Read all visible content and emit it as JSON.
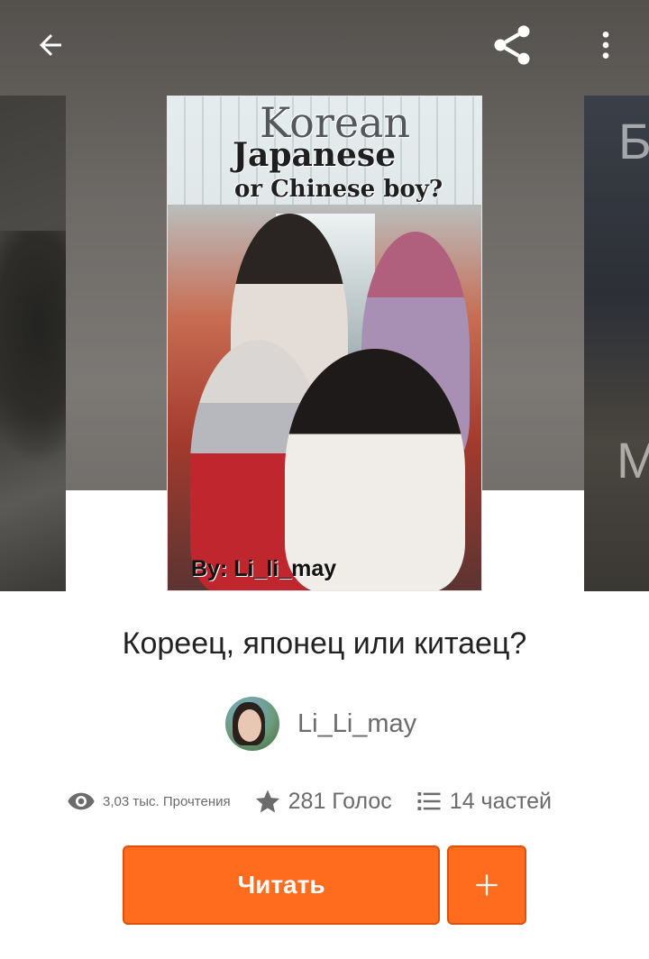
{
  "header": {
    "back_icon": "arrow-left-icon",
    "share_icon": "share-icon",
    "more_icon": "more-vertical-icon"
  },
  "cover": {
    "title_line1": "Korean",
    "title_line2": "Japanese",
    "title_line3": "or Chinese boy?",
    "byline": "By: Li_li_may"
  },
  "side_covers": {
    "right_letter_top": "Б",
    "right_letter_bottom": "М"
  },
  "story": {
    "title": "Кореец, японец или китаец?",
    "author": "Li_Li_may"
  },
  "stats": {
    "reads": "3,03 тыс. Прочтения",
    "votes": "281 Голос",
    "parts": "14 частей"
  },
  "actions": {
    "read_label": "Читать",
    "add_label": "+"
  },
  "colors": {
    "accent": "#ff6c1e",
    "accent_border": "#e0520b",
    "text_primary": "#222222",
    "text_secondary": "#6b6b6b"
  }
}
